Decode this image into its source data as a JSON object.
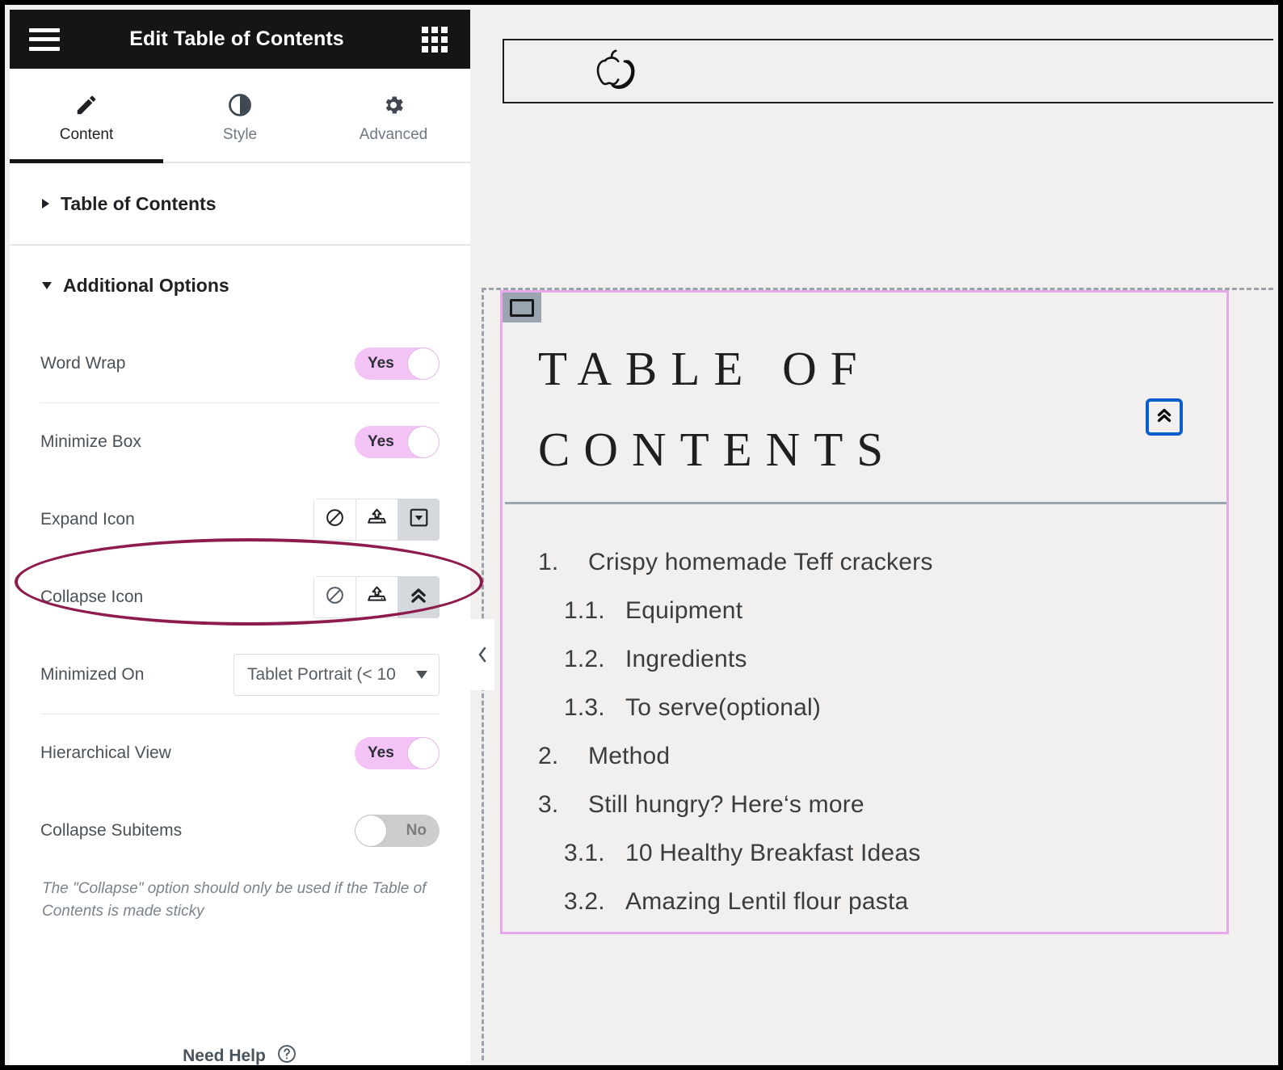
{
  "topbar": {
    "title": "Edit Table of Contents",
    "menu_icon": "hamburger-menu-icon",
    "apps_icon": "grid-apps-icon"
  },
  "tabs": [
    {
      "label": "Content",
      "icon": "pencil-icon",
      "active": true
    },
    {
      "label": "Style",
      "icon": "contrast-icon",
      "active": false
    },
    {
      "label": "Advanced",
      "icon": "gear-icon",
      "active": false
    }
  ],
  "sections": {
    "table_of_contents": {
      "label": "Table of Contents",
      "expanded": false
    },
    "additional_options": {
      "label": "Additional Options",
      "expanded": true
    }
  },
  "options": {
    "word_wrap": {
      "label": "Word Wrap",
      "value": "Yes",
      "state": "on"
    },
    "minimize_box": {
      "label": "Minimize Box",
      "value": "Yes",
      "state": "on"
    },
    "expand_icon": {
      "label": "Expand Icon",
      "selected_index": 2,
      "choices": [
        "none-icon",
        "upload-svg-icon",
        "caret-down-square-icon"
      ]
    },
    "collapse_icon": {
      "label": "Collapse Icon",
      "selected_index": 2,
      "choices": [
        "none-icon",
        "upload-svg-icon",
        "double-chevron-up-icon"
      ]
    },
    "minimized_on": {
      "label": "Minimized On",
      "value": "Tablet Portrait (< 10"
    },
    "hierarchical_view": {
      "label": "Hierarchical View",
      "value": "Yes",
      "state": "on"
    },
    "collapse_subitems": {
      "label": "Collapse Subitems",
      "value": "No",
      "state": "off"
    },
    "hint": "The \"Collapse\" option should only be used if the Table of Contents is made sticky"
  },
  "footer": {
    "need_help": "Need Help",
    "help_icon": "question-circle-icon"
  },
  "panel_collapse": {
    "icon": "chevron-left-icon"
  },
  "annotation": {
    "shape": "ellipse-highlight",
    "color": "#8e1b4e"
  },
  "preview": {
    "site_logo": "apple-banana-logo-icon",
    "widget_handle_icon": "widget-handle-rect-icon",
    "toc_title": "TABLE OF\nCONTENTS",
    "collapse_button_icon": "double-chevron-up-icon",
    "toc_items": [
      {
        "num": "1.",
        "text": "Crispy homemade Teff crackers",
        "level": 1
      },
      {
        "num": "1.1.",
        "text": "Equipment",
        "level": 2
      },
      {
        "num": "1.2.",
        "text": "Ingredients",
        "level": 2
      },
      {
        "num": "1.3.",
        "text": "To serve(optional)",
        "level": 2
      },
      {
        "num": "2.",
        "text": "Method",
        "level": 1
      },
      {
        "num": "3.",
        "text": "Still hungry? Here‘s more",
        "level": 1
      },
      {
        "num": "3.1.",
        "text": "10 Healthy Breakfast Ideas",
        "level": 2
      },
      {
        "num": "3.2.",
        "text": "Amazing Lentil flour pasta",
        "level": 2
      }
    ]
  },
  "colors": {
    "topbar_bg": "#151515",
    "toggle_on": "#f3c3f6",
    "toggle_off": "#cdcdcd",
    "widget_outline": "#e9a7ef",
    "focus_blue": "#0b5fcc",
    "annotation": "#8e1b4e",
    "canvas_bg": "#f1f0ee"
  }
}
